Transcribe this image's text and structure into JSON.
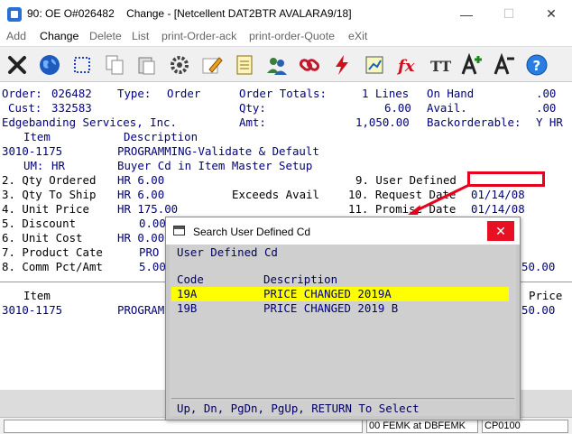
{
  "window": {
    "title": "90: OE O#026482    Change - [Netcellent DAT2BTR AVALARA9/18]",
    "min_glyph": "—",
    "max_glyph": "☐",
    "close_glyph": "✕"
  },
  "menu": {
    "items": [
      {
        "label": "Add",
        "active": false
      },
      {
        "label": "Change",
        "active": true
      },
      {
        "label": "Delete",
        "active": false
      },
      {
        "label": "List",
        "active": false
      },
      {
        "label": "print-Order-ack",
        "active": false
      },
      {
        "label": "print-order-Quote",
        "active": false
      },
      {
        "label": "eXit",
        "active": false
      }
    ]
  },
  "toolbar": {
    "icons": [
      "close-x-icon",
      "globe-icon",
      "select-rectangle-icon",
      "copy-icon",
      "paste-icon",
      "settings-gear-icon",
      "edit-pencil-icon",
      "notepad-icon",
      "users-icon",
      "link-chain-icon",
      "lightning-icon",
      "calculator-chart-icon",
      "function-fx-icon",
      "font-tt-icon",
      "font-increase-icon",
      "font-decrease-icon",
      "help-icon"
    ],
    "fx_label": "fx",
    "tt_label": "TT"
  },
  "order": {
    "order_label": "Order:",
    "order_no": "026482",
    "type_label": "Type:",
    "type_value": "Order",
    "totals_label": "Order Totals:",
    "lines_value": "1 Lines",
    "onhand_label": "On Hand",
    "onhand_value": ".00",
    "cust_label": "Cust:",
    "cust_no": "332583",
    "qty_label": "Qty:",
    "qty_value": "6.00",
    "avail_label": "Avail.",
    "avail_value": ".00",
    "customer_name": "Edgebanding Services, Inc.",
    "amt_label": "Amt:",
    "amt_value": "1,050.00",
    "backorder_label": "Backorderable:",
    "backorder_value": "Y HR"
  },
  "line_detail": {
    "item_header": "Item",
    "desc_header": "Description",
    "item_no": "3010-1175",
    "item_desc": "PROGRAMMING-Validate & Default",
    "um_label": "UM:",
    "um_value": "HR",
    "um_desc": "Buyer Cd in Item Master Setup",
    "f2_label": "2. Qty Ordered",
    "f2_value": "HR 6.00",
    "f3_label": "3. Qty To Ship",
    "f3_value": "HR 6.00",
    "exceeds": "Exceeds Avail",
    "f4_label": "4. Unit Price",
    "f4_value": "HR 175.00",
    "f5_label": "5. Discount",
    "f5_value": "0.00",
    "f6_label": "6. Unit Cost",
    "f6_value": "HR 0.00",
    "f7_label": "7. Product Cate",
    "f7_value": "PRO",
    "f8_label": "8. Comm Pct/Amt",
    "f8_value": "5.00",
    "f9_label": "9. User Defined",
    "f10_label": "10. Request Date",
    "f10_value": "01/14/08",
    "f11_label": "11. Promise Date",
    "f11_value": "01/14/08",
    "right_amt": "50.00"
  },
  "lower_grid": {
    "item_header": "Item",
    "price_header": "Price",
    "row_item": "3010-1175",
    "row_desc": "PROGRAM",
    "row_price": "50.00"
  },
  "dialog": {
    "title": "Search User Defined Cd",
    "close_glyph": "✕",
    "heading": "User Defined Cd",
    "col_code": "Code",
    "col_desc": "Description",
    "rows": [
      {
        "code": "19A",
        "desc": "PRICE CHANGED 2019A"
      },
      {
        "code": "19B",
        "desc": "PRICE CHANGED 2019 B"
      }
    ],
    "footer": "Up, Dn, PgDn, PgUp, RETURN To Select"
  },
  "status": {
    "field1": "",
    "field2": "00 FEMK at DBFEMK",
    "field3": "CP0100"
  },
  "colors": {
    "navy": "#000080",
    "highlight": "#ffff00",
    "annotation_red": "#e8001c"
  }
}
